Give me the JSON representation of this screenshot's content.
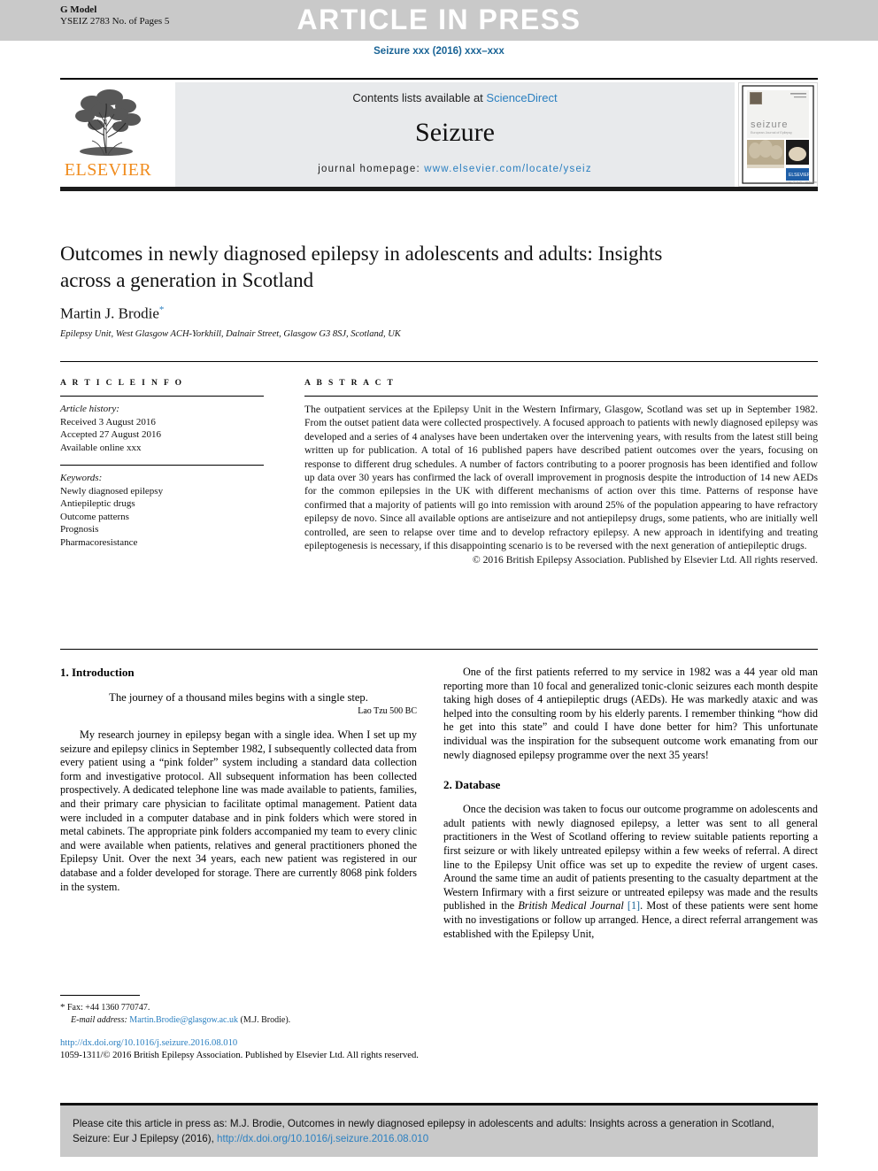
{
  "header": {
    "g_model": "G Model",
    "article_id": "YSEIZ 2783 No. of Pages 5",
    "banner": "ARTICLE IN PRESS",
    "running_head": "Seizure xxx (2016) xxx–xxx"
  },
  "masthead": {
    "contents_prefix": "Contents lists available at ",
    "sciencedirect": "ScienceDirect",
    "journal_name": "Seizure",
    "homepage_prefix": "journal homepage: ",
    "homepage_url": "www.elsevier.com/locate/yseiz",
    "publisher": "ELSEVIER"
  },
  "article": {
    "title": "Outcomes in newly diagnosed epilepsy in adolescents and adults: Insights across a generation in Scotland",
    "author": "Martin J. Brodie",
    "author_marker": "*",
    "affiliation": "Epilepsy Unit, West Glasgow ACH-Yorkhill, Dalnair Street, Glasgow G3 8SJ, Scotland, UK"
  },
  "article_info": {
    "label": "A R T I C L E   I N F O",
    "history_label": "Article history:",
    "received": "Received 3 August 2016",
    "accepted": "Accepted 27 August 2016",
    "available": "Available online xxx",
    "keywords_label": "Keywords:",
    "keywords": [
      "Newly diagnosed epilepsy",
      "Antiepileptic drugs",
      "Outcome patterns",
      "Prognosis",
      "Pharmacoresistance"
    ]
  },
  "abstract": {
    "label": "A B S T R A C T",
    "text": "The outpatient services at the Epilepsy Unit in the Western Infirmary, Glasgow, Scotland was set up in September 1982. From the outset patient data were collected prospectively. A focused approach to patients with newly diagnosed epilepsy was developed and a series of 4 analyses have been undertaken over the intervening years, with results from the latest still being written up for publication. A total of 16 published papers have described patient outcomes over the years, focusing on response to different drug schedules. A number of factors contributing to a poorer prognosis has been identified and follow up data over 30 years has confirmed the lack of overall improvement in prognosis despite the introduction of 14 new AEDs for the common epilepsies in the UK with different mechanisms of action over this time. Patterns of response have confirmed that a majority of patients will go into remission with around 25% of the population appearing to have refractory epilepsy de novo. Since all available options are antiseizure and not antiepilepsy drugs, some patients, who are initially well controlled, are seen to relapse over time and to develop refractory epilepsy. A new approach in identifying and treating epileptogenesis is necessary, if this disappointing scenario is to be reversed with the next generation of antiepileptic drugs.",
    "copyright": "© 2016 British Epilepsy Association. Published by Elsevier Ltd. All rights reserved."
  },
  "body": {
    "section1_heading": "1. Introduction",
    "quote": "The journey of a thousand miles begins with a single step.",
    "quote_attrib": "Lao Tzu 500 BC",
    "intro_para": "My research journey in epilepsy began with a single idea. When I set up my seizure and epilepsy clinics in September 1982, I subsequently collected data from every patient using a “pink folder” system including a standard data collection form and investigative protocol. All subsequent information has been collected prospectively. A dedicated telephone line was made available to patients, families, and their primary care physician to facilitate optimal management. Patient data were included in a computer database and in pink folders which were stored in metal cabinets. The appropriate pink folders accompanied my team to every clinic and were available when patients, relatives and general practitioners phoned the Epilepsy Unit. Over the next 34 years, each new patient was registered in our database and a folder developed for storage. There are currently 8068 pink folders in the system.",
    "right_para1": "One of the first patients referred to my service in 1982 was a 44 year old man reporting more than 10 focal and generalized tonic-clonic seizures each month despite taking high doses of 4 antiepileptic drugs (AEDs). He was markedly ataxic and was helped into the consulting room by his elderly parents. I remember thinking “how did he get into this state” and could I have done better for him? This unfortunate individual was the inspiration for the subsequent outcome work emanating from our newly diagnosed epilepsy programme over the next 35 years!",
    "section2_heading": "2. Database",
    "right_para2_a": "Once the decision was taken to focus our outcome programme on adolescents and adult patients with newly diagnosed epilepsy, a letter was sent to all general practitioners in the West of Scotland offering to review suitable patients reporting a first seizure or with likely untreated epilepsy within a few weeks of referral. A direct line to the Epilepsy Unit office was set up to expedite the review of urgent cases. Around the same time an audit of patients presenting to the casualty department at the Western Infirmary with a first seizure or untreated epilepsy was made and the results published in the ",
    "right_para2_journal": "British Medical Journal",
    "right_para2_ref": " [1]",
    "right_para2_b": ". Most of these patients were sent home with no investigations or follow up arranged. Hence, a direct referral arrangement was established with the Epilepsy Unit,"
  },
  "footnote": {
    "marker": "*",
    "fax": "Fax: +44 1360 770747.",
    "email_label": "E-mail address:",
    "email": "Martin.Brodie@glasgow.ac.uk",
    "email_suffix": "(M.J. Brodie)."
  },
  "doi": {
    "url": "http://dx.doi.org/10.1016/j.seizure.2016.08.010",
    "issn_line": "1059-1311/© 2016 British Epilepsy Association. Published by Elsevier Ltd. All rights reserved."
  },
  "citation_box": {
    "prefix": "Please cite this article in press as: M.J. Brodie, Outcomes in newly diagnosed epilepsy in adolescents and adults: Insights across a generation in Scotland, Seizure: Eur J Epilepsy (2016), ",
    "link": "http://dx.doi.org/10.1016/j.seizure.2016.08.010"
  },
  "colors": {
    "band_gray": "#c9c9c9",
    "link_blue": "#2a7fc0",
    "running_head_blue": "#1a6496",
    "elsevier_orange": "#F08C1E",
    "panel_gray": "#e8eaec"
  }
}
